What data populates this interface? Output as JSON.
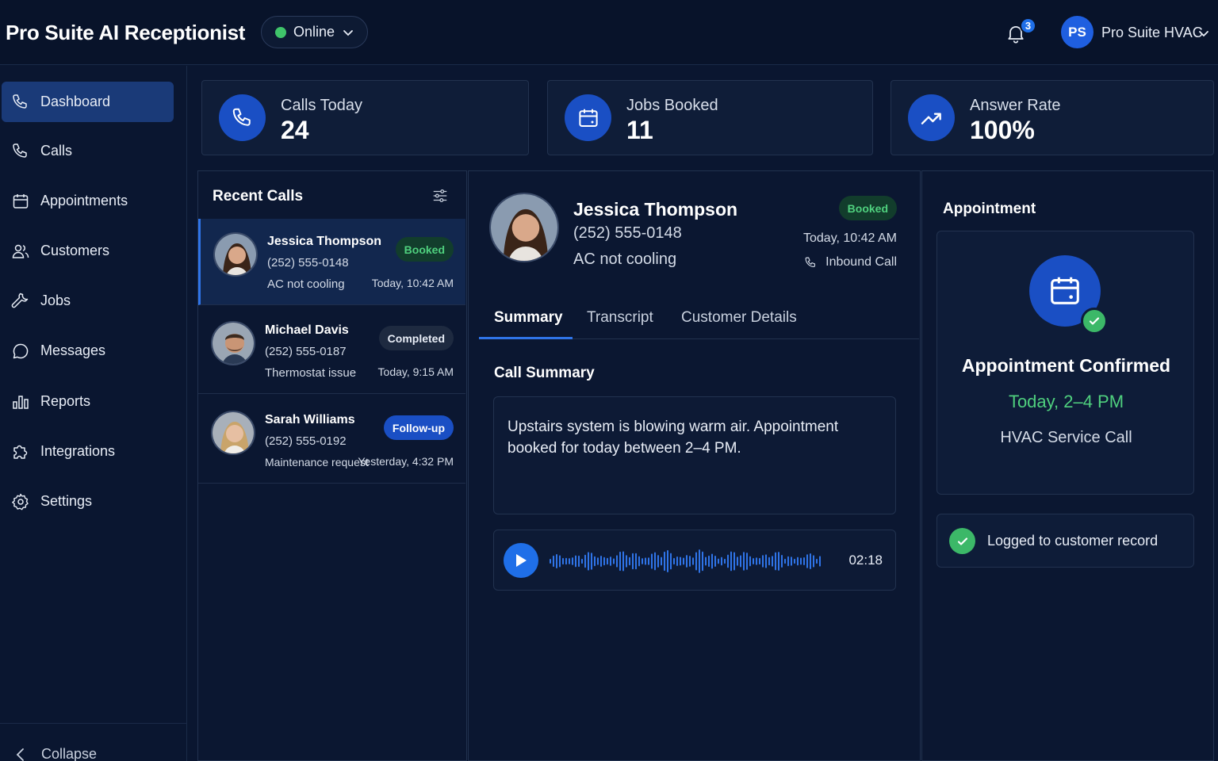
{
  "app": {
    "title": "Pro Suite AI Receptionist"
  },
  "header": {
    "status": "Online",
    "notifications_count": "3",
    "account_initials": "PS",
    "account_name": "Pro Suite HVAC"
  },
  "sidebar": {
    "items": [
      {
        "label": "Dashboard",
        "icon": "phone-icon",
        "active": true
      },
      {
        "label": "Calls",
        "icon": "phone-icon"
      },
      {
        "label": "Appointments",
        "icon": "calendar-icon"
      },
      {
        "label": "Customers",
        "icon": "users-icon"
      },
      {
        "label": "Jobs",
        "icon": "wrench-icon"
      },
      {
        "label": "Messages",
        "icon": "chat-bubble-icon"
      },
      {
        "label": "Reports",
        "icon": "bar-chart-icon"
      },
      {
        "label": "Integrations",
        "icon": "puzzle-icon"
      },
      {
        "label": "Settings",
        "icon": "gear-icon"
      }
    ],
    "collapse_label": "Collapse"
  },
  "stats": [
    {
      "label": "Calls Today",
      "value": "24",
      "icon": "phone-icon"
    },
    {
      "label": "Jobs Booked",
      "value": "11",
      "icon": "calendar-icon"
    },
    {
      "label": "Answer Rate",
      "value": "100%",
      "icon": "trending-up-icon"
    }
  ],
  "recent_calls": {
    "title": "Recent Calls",
    "items": [
      {
        "name": "Jessica Thompson",
        "phone": "(252) 555-0148",
        "issue": "AC not cooling",
        "time": "Today, 10:42 AM",
        "status": "Booked"
      },
      {
        "name": "Michael Davis",
        "phone": "(252) 555-0187",
        "issue": "Thermostat issue",
        "time": "Today, 9:15 AM",
        "status": "Completed"
      },
      {
        "name": "Sarah Williams",
        "phone": "(252) 555-0192",
        "issue": "Maintenance request",
        "time": "Yesterday, 4:32 PM",
        "status": "Follow-up"
      }
    ]
  },
  "call_detail": {
    "name": "Jessica Thompson",
    "phone": "(252) 555-0148",
    "issue": "AC not cooling",
    "status": "Booked",
    "time": "Today, 10:42 AM",
    "call_type": "Inbound Call",
    "tabs": [
      "Summary",
      "Transcript",
      "Customer Details"
    ],
    "section_title": "Call Summary",
    "summary": "Upstairs system is blowing warm air. Appointment booked for today between 2–4 PM.",
    "audio_duration": "02:18"
  },
  "appointment": {
    "title": "Appointment",
    "confirmed_label": "Appointment Confirmed",
    "when": "Today, 2–4 PM",
    "service": "HVAC Service Call",
    "logged_label": "Logged to customer record"
  },
  "colors": {
    "background": "#0a1630",
    "accent": "#1f6fe8",
    "success": "#4fd07e"
  }
}
